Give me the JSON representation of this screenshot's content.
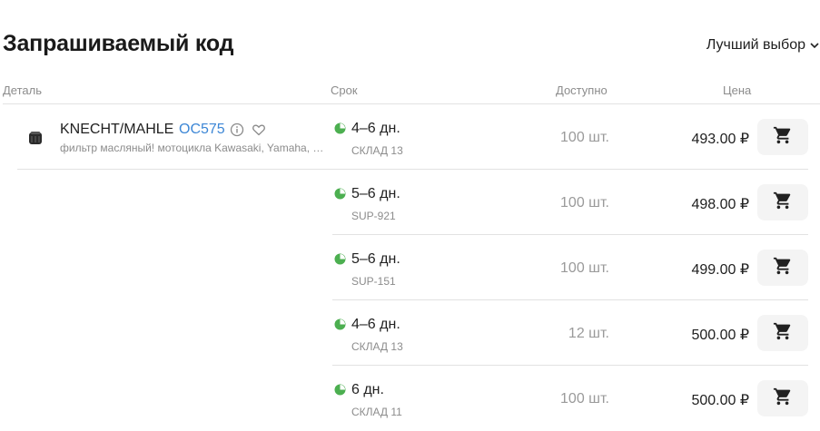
{
  "title": "Запрашиваемый код",
  "sort": {
    "label": "Лучший выбор"
  },
  "columns": {
    "part": "Деталь",
    "term": "Срок",
    "available": "Доступно",
    "price": "Цена"
  },
  "part": {
    "brand": "KNECHT/MAHLE",
    "code": "OC575",
    "description": "фильтр масляный! мотоцикла Kawasaki, Yamaha, Suzuki"
  },
  "offers": [
    {
      "term": "4–6 дн.",
      "warehouse": "СКЛАД 13",
      "qty": "100 шт.",
      "price": "493.00 ₽"
    },
    {
      "term": "5–6 дн.",
      "warehouse": "SUP-921",
      "qty": "100 шт.",
      "price": "498.00 ₽"
    },
    {
      "term": "5–6 дн.",
      "warehouse": "SUP-151",
      "qty": "100 шт.",
      "price": "499.00 ₽"
    },
    {
      "term": "4–6 дн.",
      "warehouse": "СКЛАД 13",
      "qty": "12 шт.",
      "price": "500.00 ₽"
    },
    {
      "term": "6 дн.",
      "warehouse": "СКЛАД 11",
      "qty": "100 шт.",
      "price": "500.00 ₽"
    }
  ],
  "colors": {
    "accent": "#3d87d6",
    "status_green": "#4caf50"
  }
}
